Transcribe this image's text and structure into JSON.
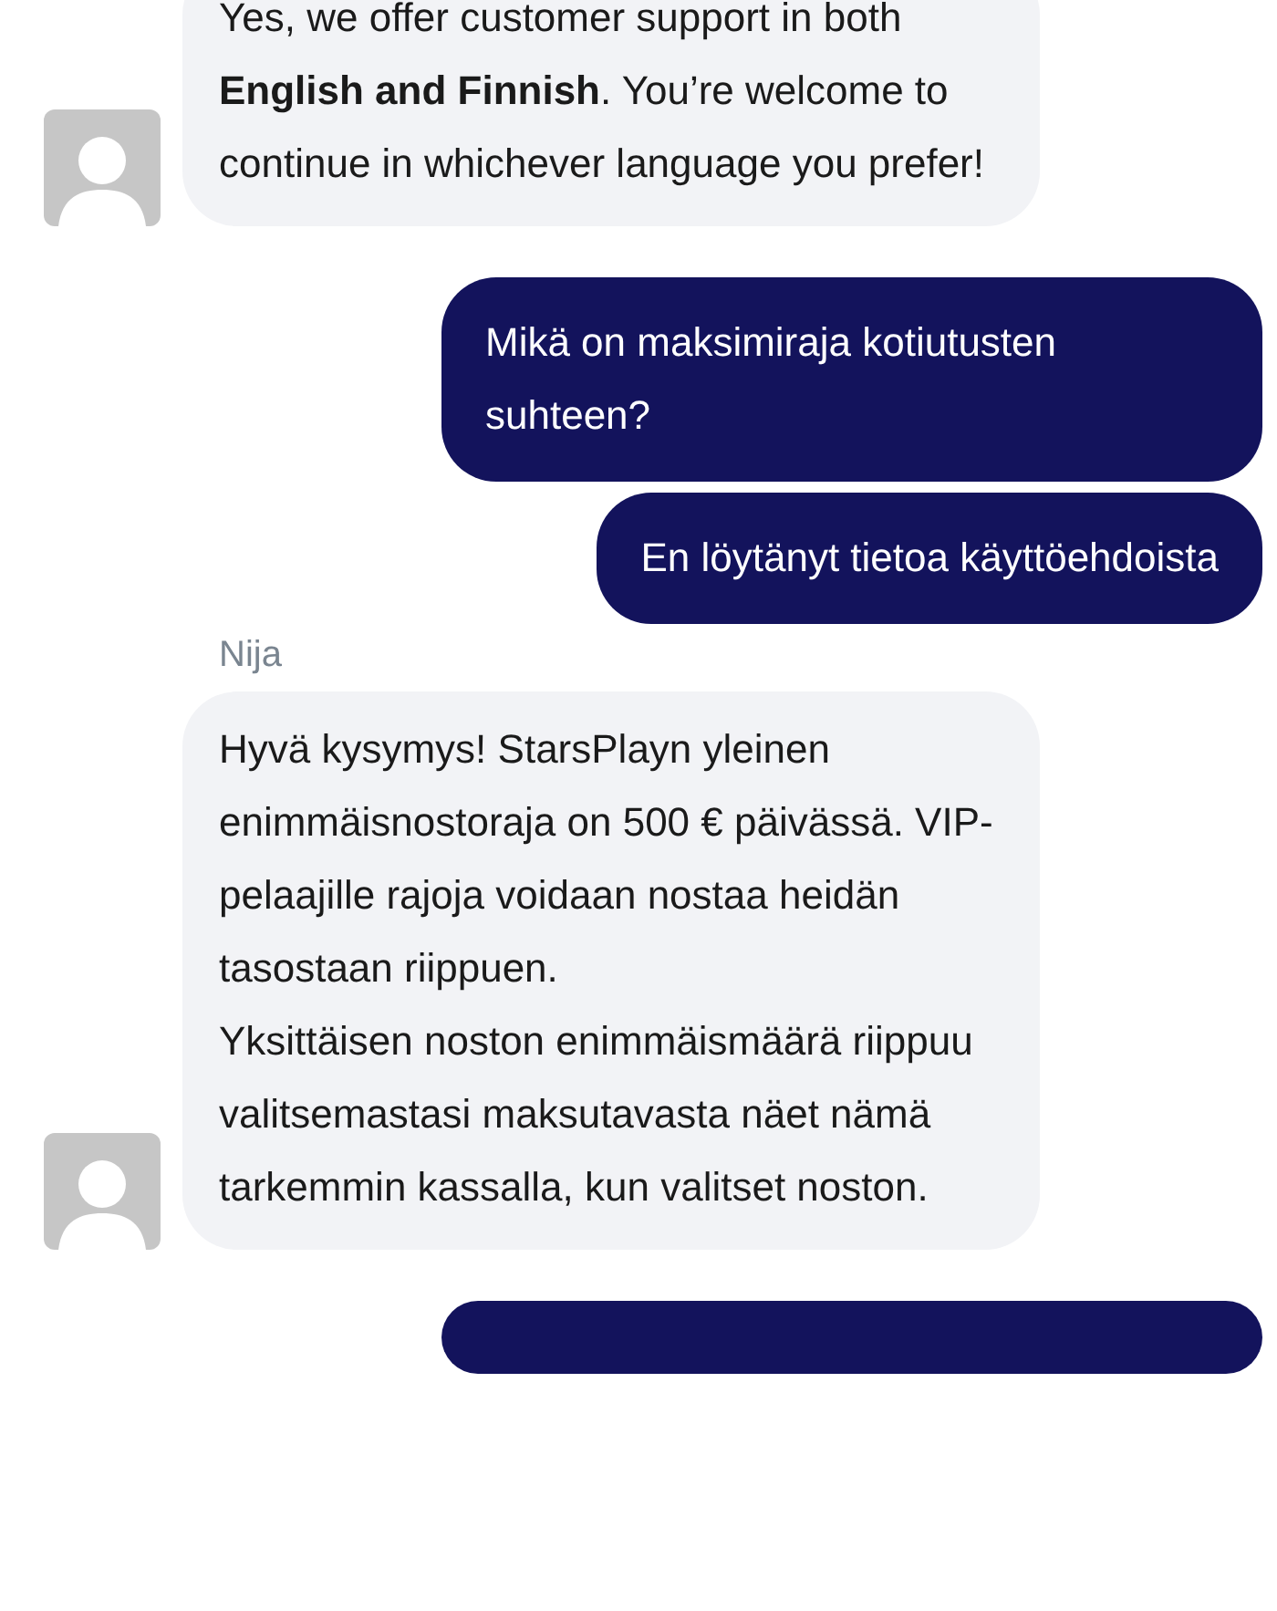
{
  "messages": [
    {
      "kind": "agent",
      "paragraphs": [
        "Yes, we offer customer support in both **English and Finnish**. You’re welcome to continue in whichever language you prefer!"
      ]
    },
    {
      "kind": "user",
      "paragraphs": [
        "Mikä on maksimiraja kotiutusten suhteen?"
      ]
    },
    {
      "kind": "user",
      "paragraphs": [
        "En löytänyt tietoa käyttöehdoista"
      ]
    },
    {
      "kind": "agent",
      "name": "Nija",
      "paragraphs": [
        "Hyvä kysymys! StarsPlayn yleinen enimmäisnostoraja on 500 € päivässä. VIP-pelaajille rajoja voidaan nostaa heidän tasostaan riippuen.",
        "Yksittäisen noston enimmäismäärä riippuu valitsemastasi maksutavasta näet nämä tarkemmin kassalla, kun valitset noston."
      ]
    },
    {
      "kind": "user_partial"
    }
  ]
}
